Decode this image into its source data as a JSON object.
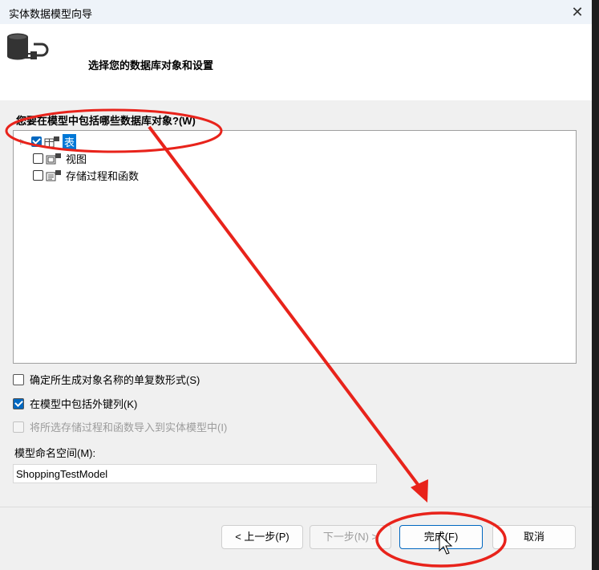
{
  "window": {
    "title": "实体数据模型向导",
    "close_glyph": "✕"
  },
  "header": {
    "title": "选择您的数据库对象和设置",
    "icon": "database-connect-icon"
  },
  "objects_section": {
    "label": "您要在模型中包括哪些数据库对象?(W)",
    "items": [
      {
        "label": "表",
        "checked": true,
        "selected": true
      },
      {
        "label": "视图",
        "checked": false,
        "selected": false
      },
      {
        "label": "存储过程和函数",
        "checked": false,
        "selected": false
      }
    ]
  },
  "options": {
    "pluralize": {
      "label": "确定所生成对象名称的单复数形式(S)",
      "checked": false
    },
    "foreign_keys": {
      "label": "在模型中包括外键列(K)",
      "checked": true
    },
    "import_sprocs": {
      "label": "将所选存储过程和函数导入到实体模型中(I)",
      "checked": false,
      "disabled": true
    }
  },
  "namespace": {
    "label": "模型命名空间(M):",
    "value": "ShoppingTestModel"
  },
  "buttons": {
    "previous": "< 上一步(P)",
    "next": "下一步(N) >",
    "finish": "完成(F)",
    "cancel": "取消"
  },
  "colors": {
    "accent": "#0067c0",
    "selection": "#0078d7",
    "annotation": "#e8231b"
  }
}
